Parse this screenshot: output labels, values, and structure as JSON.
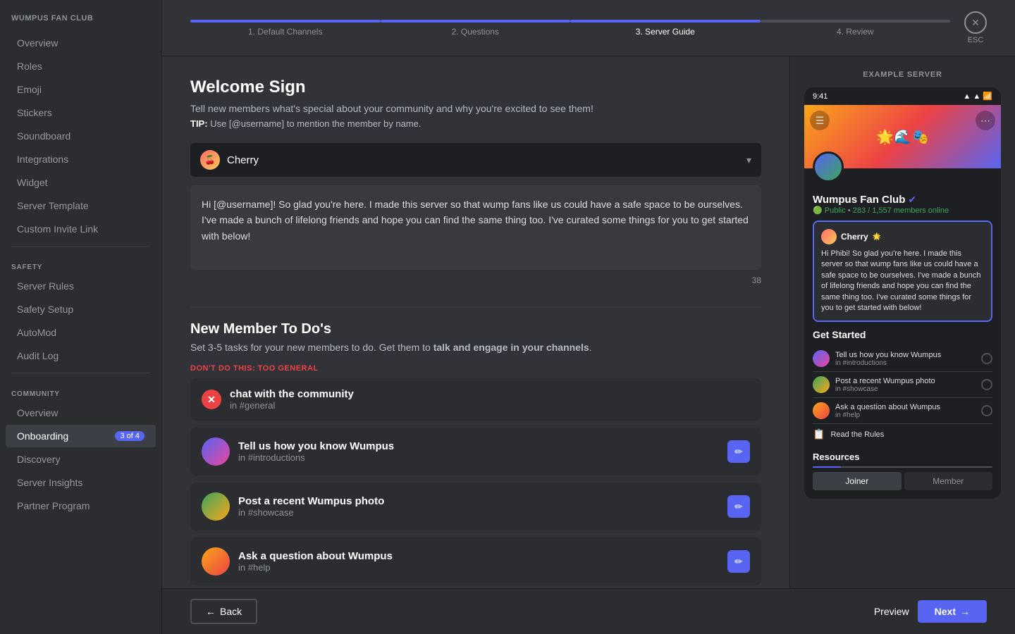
{
  "sidebar": {
    "server_name": "WUMPUS FAN CLUB",
    "items_main": [
      {
        "label": "Overview",
        "active": false
      },
      {
        "label": "Roles",
        "active": false
      },
      {
        "label": "Emoji",
        "active": false
      },
      {
        "label": "Stickers",
        "active": false
      },
      {
        "label": "Soundboard",
        "active": false
      },
      {
        "label": "Integrations",
        "active": false
      },
      {
        "label": "Widget",
        "active": false
      },
      {
        "label": "Server Template",
        "active": false
      },
      {
        "label": "Custom Invite Link",
        "active": false
      }
    ],
    "section_safety": "SAFETY",
    "items_safety": [
      {
        "label": "Server Rules",
        "active": false
      },
      {
        "label": "Safety Setup",
        "active": false
      },
      {
        "label": "AutoMod",
        "active": false
      },
      {
        "label": "Audit Log",
        "active": false
      }
    ],
    "section_community": "COMMUNITY",
    "items_community": [
      {
        "label": "Overview",
        "active": false
      },
      {
        "label": "Onboarding",
        "active": true,
        "badge": "3 of 4"
      },
      {
        "label": "Discovery",
        "active": false
      },
      {
        "label": "Server Insights",
        "active": false
      },
      {
        "label": "Partner Program",
        "active": false
      }
    ]
  },
  "progress": {
    "steps": [
      {
        "label": "1. Default Channels",
        "state": "done"
      },
      {
        "label": "2. Questions",
        "state": "done"
      },
      {
        "label": "3. Server Guide",
        "state": "active"
      },
      {
        "label": "4. Review",
        "state": "inactive"
      }
    ]
  },
  "esc": {
    "icon": "✕",
    "label": "ESC"
  },
  "form": {
    "title": "Welcome Sign",
    "description": "Tell new members what's special about your community and why you're excited to see them!",
    "tip_label": "TIP:",
    "tip_text": " Use [@username] to mention the member by name.",
    "dropdown_name": "Cherry",
    "message_text": "Hi [@username]! So glad you're here. I made this server so that wump fans like us could have a safe space to be ourselves. I've made a bunch of lifelong friends and hope you can find the same thing too. I've curated some things for you to get started with below!",
    "char_count": "38",
    "new_member_title": "New Member To Do's",
    "new_member_desc": "Set 3-5 tasks for your new members to do. Get them to ",
    "new_member_desc_bold": "talk and engage in your channels",
    "new_member_desc_end": ".",
    "dont_do_label": "DON'T DO THIS: TOO GENERAL",
    "bad_task_name": "chat with the community",
    "bad_task_channel": "in #general",
    "good_tasks": [
      {
        "name": "Tell us how you know Wumpus",
        "channel": "in #introductions"
      },
      {
        "name": "Post a recent Wumpus photo",
        "channel": "in #showcase"
      },
      {
        "name": "Ask a question about Wumpus",
        "channel": "in #help"
      }
    ]
  },
  "preview": {
    "example_label": "EXAMPLE SERVER",
    "time": "9:41",
    "server_name": "Wumpus Fan Club",
    "server_public": "Public",
    "server_members": "283 / 1,557 members online",
    "cherry_name": "Cherry",
    "welcome_text": "Hi Phibi! So glad you're here. I made this server so that wump fans like us could have a safe space to be ourselves. I've made a bunch of lifelong friends and hope you can find the same thing too. I've curated some things for you to get started with below!",
    "get_started_title": "Get Started",
    "onboarding_tasks": [
      {
        "name": "Tell us how you know Wumpus",
        "channel": "in #introductions"
      },
      {
        "name": "Post a recent Wumpus photo",
        "channel": "in #showcase"
      },
      {
        "name": "Ask a question about Wumpus",
        "channel": "in #help"
      }
    ],
    "read_rules": "Read the Rules",
    "resources_title": "Resources",
    "resource_tabs": [
      "Joiner",
      "Member"
    ],
    "active_tab": "Joiner"
  },
  "footer": {
    "back_label": "Back",
    "preview_label": "Preview",
    "next_label": "Next"
  }
}
